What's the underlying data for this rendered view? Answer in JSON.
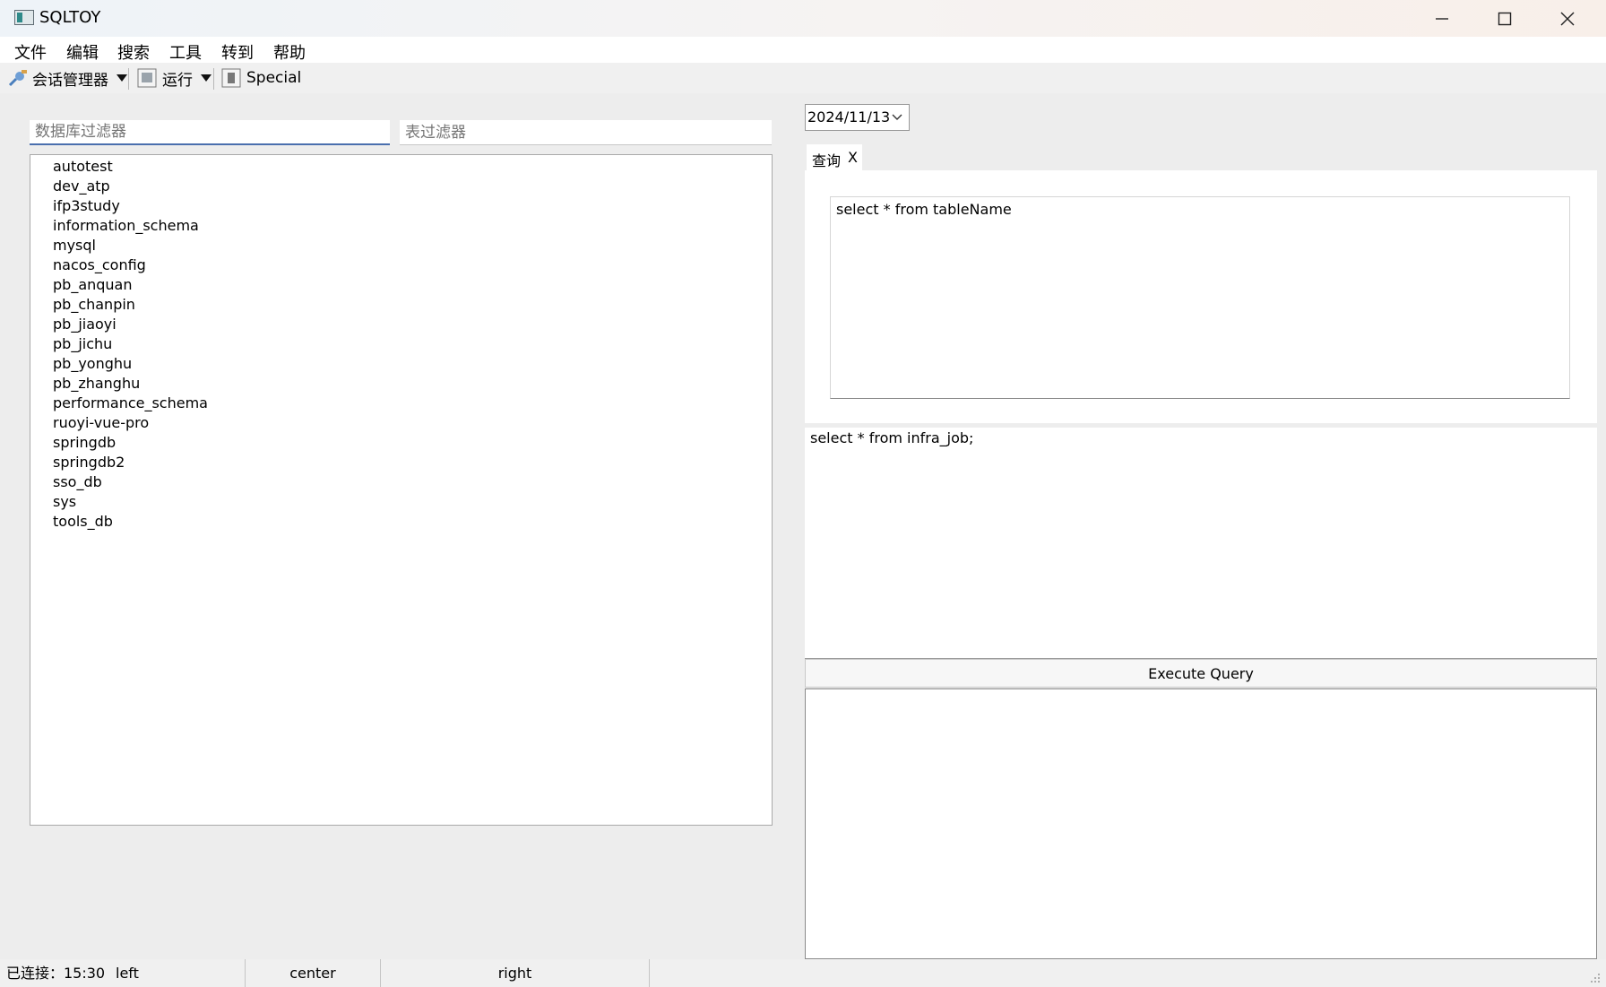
{
  "window": {
    "title": "SQLTOY"
  },
  "menubar": {
    "items": [
      "文件",
      "编辑",
      "搜索",
      "工具",
      "转到",
      "帮助"
    ]
  },
  "toolbar": {
    "session_label": "会话管理器",
    "run_label": "运行",
    "special_label": "Special"
  },
  "left": {
    "db_filter_placeholder": "数据库过滤器",
    "table_filter_placeholder": "表过滤器",
    "databases": [
      "autotest",
      "dev_atp",
      "ifp3study",
      "information_schema",
      "mysql",
      "nacos_config",
      "pb_anquan",
      "pb_chanpin",
      "pb_jiaoyi",
      "pb_jichu",
      "pb_yonghu",
      "pb_zhanghu",
      "performance_schema",
      "ruoyi-vue-pro",
      "springdb",
      "springdb2",
      "sso_db",
      "sys",
      "tools_db"
    ]
  },
  "right": {
    "date_value": "2024/11/13",
    "tab_label": "查询",
    "tab_close": "X",
    "query_editor_text": "select * from tableName",
    "query_text": "select * from infra_job;",
    "execute_label": "Execute Query"
  },
  "statusbar": {
    "connection": "已连接：15:30",
    "left": "left",
    "center": "center",
    "right": "right"
  },
  "colors": {
    "focus_accent": "#4a6fae",
    "background": "#ededed"
  }
}
